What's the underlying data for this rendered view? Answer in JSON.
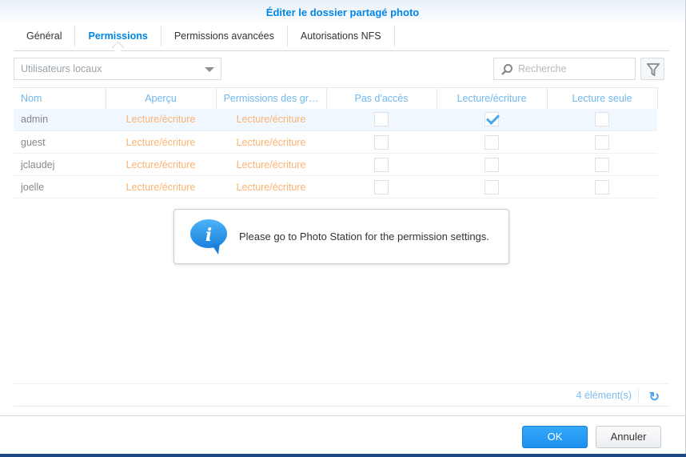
{
  "title": "Éditer le dossier partagé photo",
  "tabs": [
    "Général",
    "Permissions",
    "Permissions avancées",
    "Autorisations NFS"
  ],
  "user_type_select": "Utilisateurs locaux",
  "search_placeholder": "Recherche",
  "columns": [
    "Nom",
    "Aperçu",
    "Permissions des gr…",
    "Pas d'accès",
    "Lecture/écriture",
    "Lecture seule"
  ],
  "rows": [
    {
      "name": "admin",
      "preview": "Lecture/écriture",
      "group": "Lecture/écriture",
      "no_access": false,
      "rw": true,
      "ro": false
    },
    {
      "name": "guest",
      "preview": "Lecture/écriture",
      "group": "Lecture/écriture",
      "no_access": false,
      "rw": false,
      "ro": false
    },
    {
      "name": "jclaudej",
      "preview": "Lecture/écriture",
      "group": "Lecture/écriture",
      "no_access": false,
      "rw": false,
      "ro": false
    },
    {
      "name": "joelle",
      "preview": "Lecture/écriture",
      "group": "Lecture/écriture",
      "no_access": false,
      "rw": false,
      "ro": false
    }
  ],
  "message": "Please go to Photo Station for the permission settings.",
  "item_count": "4 élément(s)",
  "ok_label": "OK",
  "cancel_label": "Annuler"
}
